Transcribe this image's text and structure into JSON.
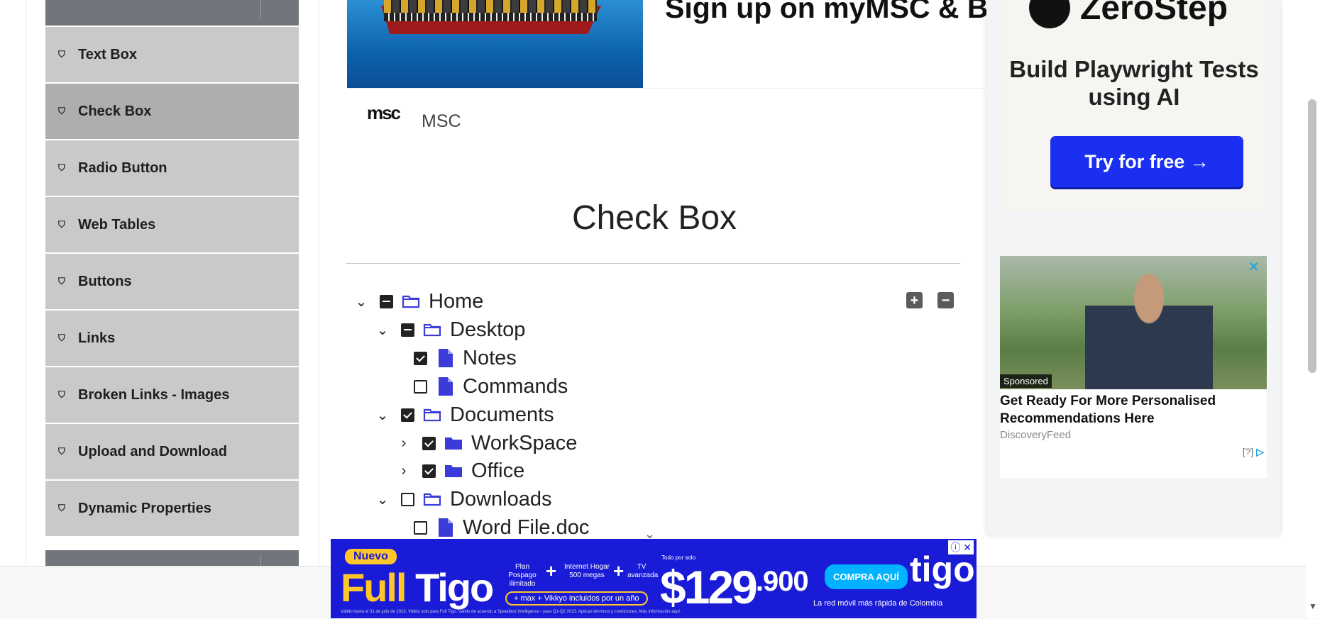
{
  "sidebar": {
    "items": [
      {
        "label": "Text Box",
        "active": false
      },
      {
        "label": "Check Box",
        "active": true
      },
      {
        "label": "Radio Button",
        "active": false
      },
      {
        "label": "Web Tables",
        "active": false
      },
      {
        "label": "Buttons",
        "active": false
      },
      {
        "label": "Links",
        "active": false
      },
      {
        "label": "Broken Links - Images",
        "active": false
      },
      {
        "label": "Upload and Download",
        "active": false
      },
      {
        "label": "Dynamic Properties",
        "active": false
      }
    ]
  },
  "top_ad": {
    "headline": "Sign up on myMSC & B",
    "brand": "MSC",
    "logo_text": "msc"
  },
  "page": {
    "title": "Check Box"
  },
  "tree": {
    "expand_all_icon": "plus-square-icon",
    "collapse_all_icon": "minus-square-icon",
    "nodes": [
      {
        "label": "Home",
        "type": "folder-open",
        "state": "half",
        "expanded": true
      },
      {
        "label": "Desktop",
        "type": "folder-open",
        "state": "half",
        "expanded": true
      },
      {
        "label": "Notes",
        "type": "file",
        "state": "checked"
      },
      {
        "label": "Commands",
        "type": "file",
        "state": "unchecked"
      },
      {
        "label": "Documents",
        "type": "folder-open",
        "state": "checked",
        "expanded": true
      },
      {
        "label": "WorkSpace",
        "type": "folder-closed",
        "state": "checked",
        "expanded": false
      },
      {
        "label": "Office",
        "type": "folder-closed",
        "state": "checked",
        "expanded": false
      },
      {
        "label": "Downloads",
        "type": "folder-open",
        "state": "unchecked",
        "expanded": true
      },
      {
        "label": "Word File.doc",
        "type": "file",
        "state": "unchecked"
      }
    ]
  },
  "right_ad": {
    "brand": "ZeroStep",
    "headline": "Build Playwright Tests using AI",
    "cta": "Try for free →",
    "sponsored_label": "Sponsored",
    "sponsored_title": "Get Ready For More Personalised Recommendations Here",
    "sponsored_source": "DiscoveryFeed",
    "adchoices": "[?]"
  },
  "bottom_ad": {
    "badge": "Nuevo",
    "product_a": "Full",
    "product_b": "Tigo",
    "feature_1": "Plan Pospago ilimitado",
    "feature_2": "Internet Hogar 500 megas",
    "feature_3": "TV avanzada",
    "included": "+ max + Vikkyo incluidos por un año",
    "price_prefix": "Todo por solo",
    "price": "$129",
    "price_cents": ".900",
    "cta": "COMPRA AQUÍ",
    "brand": "tigo",
    "tagline": "La red móvil más rápida de Colombia",
    "legal": "Válido hasta el 31 de julio de 2023. Válido solo para Full Tigo. Válido de acuerdo a Speedtest Intelligence - para Q1-Q2 2023. Aplican términos y condiciones. Más información aquí."
  },
  "colors": {
    "sidebar": "#c9c9c9",
    "sidebar_active": "#aeaeae",
    "folder_icon": "#3b3bd9",
    "zerostep_cta": "#1a2ff0",
    "tigo_bg": "#1a1bd6"
  }
}
